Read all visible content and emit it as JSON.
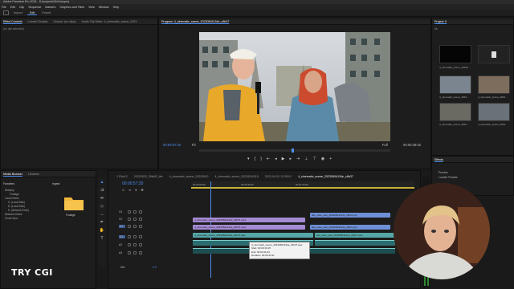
{
  "app": {
    "title": "Adobe Premiere Pro 2024 - D:\\projects\\2b\\1b\\prproj",
    "menu": [
      "File",
      "Edit",
      "Clip",
      "Sequence",
      "Markers",
      "Graphics and Titles",
      "View",
      "Window",
      "Help"
    ],
    "workspaces": [
      "Import",
      "Edit",
      "Export"
    ],
    "active_workspace": "Edit"
  },
  "source_panel": {
    "tabs": [
      "Effect Controls",
      "Lumetri Scopes",
      "Source: (no clips)",
      "Audio Clip Mixer: 4_cinematic_scene_2023"
    ],
    "empty_text": "(no clip selected)"
  },
  "program": {
    "tab": "Program: 4_cinematic_scene_20230504134e_c8b37",
    "timecode_left": "00:00:57:20",
    "timecode_right": "00:00:28:02",
    "fit": "Fit",
    "quality": "Full"
  },
  "project": {
    "tab": "Project: 0",
    "sub": "1b",
    "items": [
      {
        "label": "4_cinematic_scene_20230..."
      },
      {
        "label": ""
      },
      {
        "label": "4_cinematic_scene_2023..."
      },
      {
        "label": "4_cinematic_scene_2023..."
      },
      {
        "label": "4_cinematic_scene_2023..."
      },
      {
        "label": "4_cinematic_scene_2023..."
      }
    ]
  },
  "effects": {
    "tab": "Effects",
    "items": [
      "Presets",
      "Lumetri Presets"
    ]
  },
  "media_browser": {
    "tabs": [
      "Media Browser",
      "Libraries"
    ],
    "favorites": "Favorites",
    "ingest": "Ingest",
    "tree": [
      "Desktop",
      "Footage",
      "Local Drives",
      "C: (Local Disk)",
      "D: (Local Disk)",
      "E: (Network Drive)",
      "Network Drives",
      "Cloud Sync"
    ],
    "folder_label": "Footage"
  },
  "timeline": {
    "tabs": [
      "1 Film12",
      "20220522_39tb02_tlm",
      "4_cinematic_scene_20230510",
      "4_cinematic_scene_20230510115",
      "2023-04-02 12:28:01",
      "4_cinematic_scene_20230504134e_c8b37"
    ],
    "timecode": "00:00:57:20",
    "ruler": [
      "00:00:00:00",
      "00:00:30:00",
      "00:01:00:00"
    ],
    "tracks_video": [
      "V3",
      "V2",
      "V1"
    ],
    "tracks_audio": [
      "A1",
      "A2",
      "A3"
    ],
    "mix": "Mix",
    "mix_value": "0.0",
    "clips": {
      "v2a": "4_cinematic_scene_20230504134e_c8b37.mp4",
      "v2b": "title_case_web_20230504134e_c8b3.mp4",
      "v1a": "4_cinematic_scene_20230504134e_c8b37.mp4",
      "v1b": "title_case_web_20230504134e_c8b3.mp4",
      "a1a": "4_cinematic_scene_20230504134e_c8b37.wav",
      "a1b": "title_case_web_20230504134e_c8b37.wav"
    },
    "tooltip": [
      "4_cinematic_scene_20230504134e_c8b37.wav",
      "Start: 00:00:16:15",
      "End: 00:01:01:04",
      "Duration: 00:00:44:11"
    ]
  },
  "brand": "TRY CGI"
}
